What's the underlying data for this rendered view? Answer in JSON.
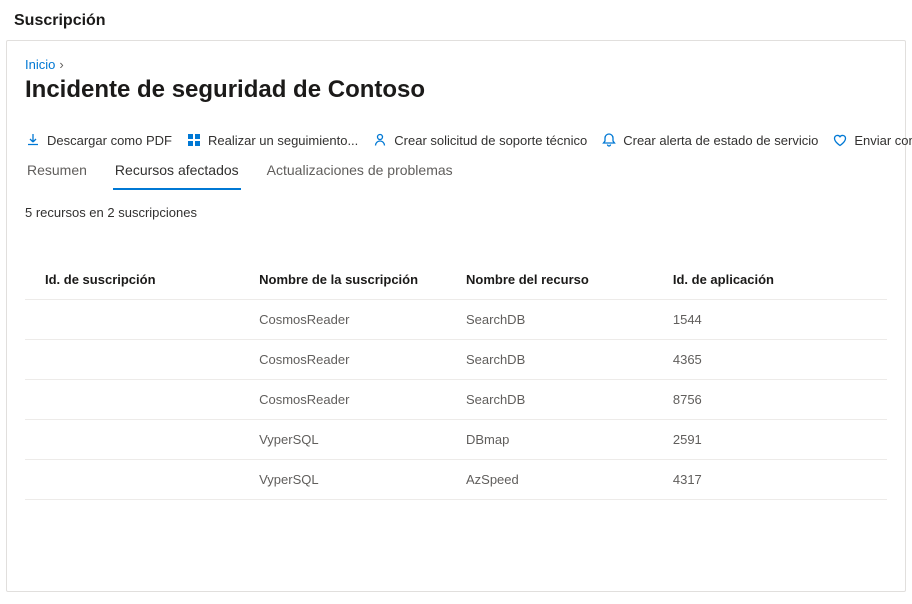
{
  "header": "Suscripción",
  "breadcrumb": {
    "home": "Inicio"
  },
  "title": "Incidente de seguridad de Contoso",
  "toolbar": {
    "download": "Descargar como PDF",
    "track": "Realizar un seguimiento...",
    "support": "Crear solicitud de soporte técnico",
    "alert": "Crear alerta de estado de servicio",
    "feedback": "Enviar comentarios"
  },
  "tabs": {
    "summary": "Resumen",
    "affected": "Recursos afectados",
    "updates": "Actualizaciones de problemas"
  },
  "summary_line": "5 recursos en 2 suscripciones",
  "table": {
    "headers": {
      "sub_id": "Id. de suscripción",
      "sub_name": "Nombre de la suscripción",
      "res_name": "Nombre del recurso",
      "app_id": "Id. de aplicación"
    },
    "rows": [
      {
        "sub_id": "",
        "sub_name": "CosmosReader",
        "res_name": "SearchDB",
        "app_id": "1544"
      },
      {
        "sub_id": "",
        "sub_name": "CosmosReader",
        "res_name": "SearchDB",
        "app_id": "4365"
      },
      {
        "sub_id": "",
        "sub_name": "CosmosReader",
        "res_name": "SearchDB",
        "app_id": "8756"
      },
      {
        "sub_id": "",
        "sub_name": "VyperSQL",
        "res_name": "DBmap",
        "app_id": "2591"
      },
      {
        "sub_id": "",
        "sub_name": "VyperSQL",
        "res_name": "AzSpeed",
        "app_id": "4317"
      }
    ]
  }
}
